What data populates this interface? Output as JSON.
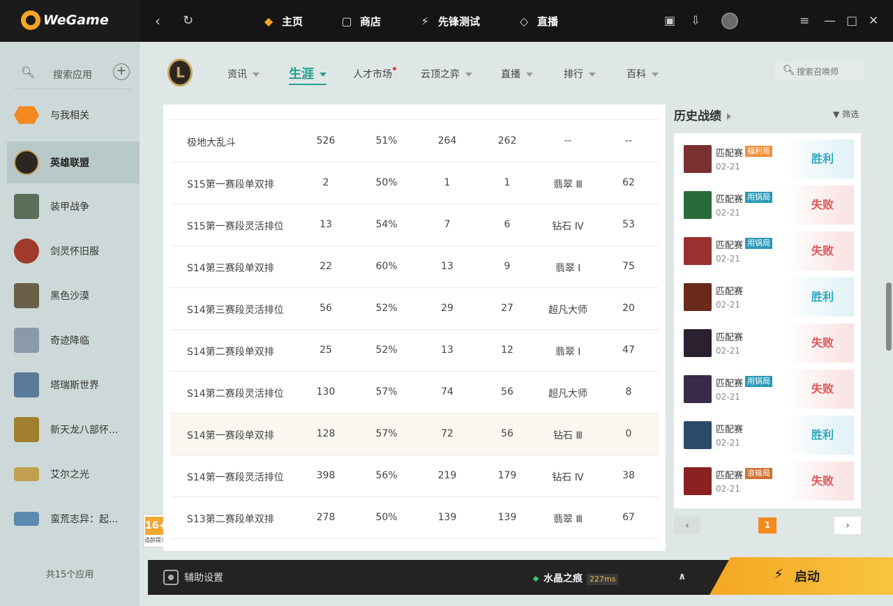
{
  "brand": {
    "name": "WeGame",
    "color": "#f5a623"
  },
  "topnav": {
    "items": [
      {
        "label": "主页",
        "icon": "home-icon",
        "active": true
      },
      {
        "label": "商店",
        "icon": "shop-bag-icon"
      },
      {
        "label": "先锋测试",
        "icon": "lightning-icon"
      },
      {
        "label": "直播",
        "icon": "live-icon"
      }
    ]
  },
  "sidebar": {
    "search_label": "搜索应用",
    "apps": [
      {
        "label": "与我相关",
        "icon": "related-icon",
        "color": "#f5891f"
      },
      {
        "label": "英雄联盟",
        "icon": "lol-icon",
        "active": true,
        "color": "#2b2620"
      },
      {
        "label": "装甲战争",
        "icon": "armored-warfare-icon",
        "color": "#5a6e5a"
      },
      {
        "label": "剑灵怀旧服",
        "icon": "blade-soul-icon",
        "color": "#a03a2a"
      },
      {
        "label": "黑色沙漠",
        "icon": "black-desert-icon",
        "color": "#6a6048"
      },
      {
        "label": "奇迹降临",
        "icon": "mu-icon",
        "color": "#8a9aaa"
      },
      {
        "label": "塔瑞斯世界",
        "icon": "tarisland-icon",
        "color": "#5a7a9a"
      },
      {
        "label": "新天龙八部怀...",
        "icon": "tianlong-icon",
        "color": "#a08030"
      },
      {
        "label": "艾尔之光",
        "icon": "elsword-icon",
        "color": "#c0a050"
      },
      {
        "label": "蛮荒志异：起...",
        "icon": "wild-icon",
        "color": "#5a8ab0"
      }
    ],
    "count_text": "共15个应用",
    "age_rating": {
      "number": "16+",
      "label": "适龄提示"
    }
  },
  "subnav": {
    "items": [
      {
        "label": "资讯",
        "caret": true
      },
      {
        "label": "生涯",
        "caret": true,
        "active": true
      },
      {
        "label": "人才市场",
        "dot": true
      },
      {
        "label": "云顶之弈",
        "caret": true
      },
      {
        "label": "直播",
        "caret": true
      },
      {
        "label": "排行",
        "caret": true
      },
      {
        "label": "百科",
        "caret": true
      }
    ],
    "search_placeholder": "搜索召唤师"
  },
  "table": {
    "rows": [
      [
        "极地大乱斗",
        "526",
        "51%",
        "264",
        "262",
        "--",
        "--"
      ],
      [
        "S15第一赛段单双排",
        "2",
        "50%",
        "1",
        "1",
        "翡翠 Ⅲ",
        "62"
      ],
      [
        "S15第一赛段灵活排位",
        "13",
        "54%",
        "7",
        "6",
        "钻石 Ⅳ",
        "53"
      ],
      [
        "S14第三赛段单双排",
        "22",
        "60%",
        "13",
        "9",
        "翡翠 Ⅰ",
        "75"
      ],
      [
        "S14第三赛段灵活排位",
        "56",
        "52%",
        "29",
        "27",
        "超凡大师",
        "20"
      ],
      [
        "S14第二赛段单双排",
        "25",
        "52%",
        "13",
        "12",
        "翡翠 Ⅰ",
        "47"
      ],
      [
        "S14第二赛段灵活排位",
        "130",
        "57%",
        "74",
        "56",
        "超凡大师",
        "8"
      ],
      [
        "S14第一赛段单双排",
        "128",
        "57%",
        "72",
        "56",
        "钻石 Ⅲ",
        "0"
      ],
      [
        "S14第一赛段灵活排位",
        "398",
        "56%",
        "219",
        "179",
        "钻石 Ⅳ",
        "38"
      ],
      [
        "S13第二赛段单双排",
        "278",
        "50%",
        "139",
        "139",
        "翡翠 Ⅲ",
        "67"
      ]
    ]
  },
  "history": {
    "title": "历史战绩",
    "filter_label": "筛选",
    "matches": [
      {
        "mode": "匹配赛",
        "tag": "福利局",
        "tag_color": "#f0903a",
        "date": "02-21",
        "result": "胜利",
        "win": true,
        "champ_color": "#7a3030"
      },
      {
        "mode": "匹配赛",
        "tag": "用锅局",
        "tag_color": "#2a9ab8",
        "date": "02-21",
        "result": "失败",
        "win": false,
        "champ_color": "#2a6a3a"
      },
      {
        "mode": "匹配赛",
        "tag": "用锅局",
        "tag_color": "#2a9ab8",
        "date": "02-21",
        "result": "失败",
        "win": false,
        "champ_color": "#9a3030"
      },
      {
        "mode": "匹配赛",
        "tag": "",
        "tag_color": "",
        "date": "02-21",
        "result": "胜利",
        "win": true,
        "champ_color": "#6a2a1a"
      },
      {
        "mode": "匹配赛",
        "tag": "",
        "tag_color": "",
        "date": "02-21",
        "result": "失败",
        "win": false,
        "champ_color": "#2a2030"
      },
      {
        "mode": "匹配赛",
        "tag": "用锅局",
        "tag_color": "#2a9ab8",
        "date": "02-21",
        "result": "失败",
        "win": false,
        "champ_color": "#3a2a4a"
      },
      {
        "mode": "匹配赛",
        "tag": "",
        "tag_color": "",
        "date": "02-21",
        "result": "胜利",
        "win": true,
        "champ_color": "#2a4a6a"
      },
      {
        "mode": "匹配赛",
        "tag": "浪输局",
        "tag_color": "#d07030",
        "date": "02-21",
        "result": "失败",
        "win": false,
        "champ_color": "#8a2020"
      }
    ],
    "page": "1"
  },
  "bottombar": {
    "assist_label": "辅助设置",
    "server_name": "水晶之痕",
    "ping": "227ms",
    "launch_label": "启动"
  }
}
